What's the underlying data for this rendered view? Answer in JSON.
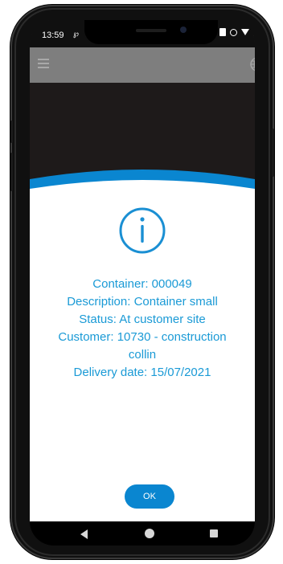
{
  "status_bar": {
    "time": "13:59",
    "notification_icon": "notification-icon",
    "icons": [
      "battery-saver-icon",
      "data-saver-icon",
      "wifi-icon",
      "battery-icon"
    ]
  },
  "toolbar": {
    "menu_icon": "hamburger-menu-icon",
    "globe_icon": "globe-icon"
  },
  "dialog": {
    "icon": "info-icon",
    "container": "Container: 000049",
    "description": "Description: Container small",
    "status": "Status: At customer site",
    "customer_line1": "Customer: 10730 - construction",
    "customer_line2": "collin",
    "delivery_date": "Delivery date: 15/07/2021",
    "ok_label": "OK"
  },
  "nav_bar": {
    "back_icon": "back-icon",
    "home_icon": "home-icon",
    "recents_icon": "recents-icon"
  },
  "colors": {
    "accent": "#1a9ad6",
    "button": "#0a86d0",
    "toolbar": "#7e7e7e"
  }
}
